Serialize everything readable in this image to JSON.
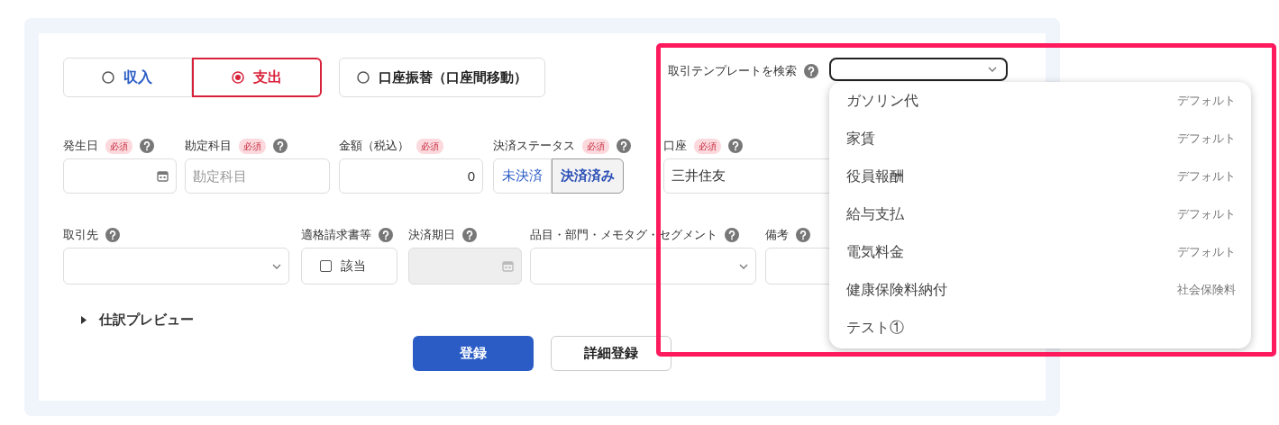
{
  "transaction_types": [
    {
      "label": "収入",
      "selected": false
    },
    {
      "label": "支出",
      "selected": true
    },
    {
      "label": "口座振替（口座間移動）",
      "selected": false
    }
  ],
  "template_search": {
    "label": "取引テンプレートを検索",
    "options": [
      {
        "name": "ガソリン代",
        "category": "デフォルト"
      },
      {
        "name": "家賃",
        "category": "デフォルト"
      },
      {
        "name": "役員報酬",
        "category": "デフォルト"
      },
      {
        "name": "給与支払",
        "category": "デフォルト"
      },
      {
        "name": "電気料金",
        "category": "デフォルト"
      },
      {
        "name": "健康保険料納付",
        "category": "社会保険料"
      },
      {
        "name": "テスト①"
      }
    ]
  },
  "fields_row1": [
    {
      "kind": "date",
      "label": "発生日",
      "badge": "必須",
      "help": true
    },
    {
      "kind": "text",
      "label": "勘定科目",
      "badge": "必須",
      "help": true,
      "placeholder": "勘定科目"
    },
    {
      "kind": "number",
      "label": "金額（税込）",
      "badge": "必須",
      "help": false,
      "value": "0"
    },
    {
      "kind": "toggle",
      "label": "決済ステータス",
      "badge": "必須",
      "help": true,
      "options": [
        {
          "label": "未決済",
          "selected": false
        },
        {
          "label": "決済済み",
          "selected": true
        }
      ]
    },
    {
      "kind": "text",
      "label": "口座",
      "badge": "必須",
      "help": true,
      "value": "三井住友"
    }
  ],
  "fields_row2": [
    {
      "kind": "select",
      "label": "取引先",
      "help": true
    },
    {
      "kind": "checkbox",
      "label": "適格請求書等",
      "help": true,
      "option": "該当",
      "checked": false
    },
    {
      "kind": "date",
      "label": "決済期日",
      "help": true,
      "disabled": true
    },
    {
      "kind": "select",
      "label": "品目・部門・メモタグ・セグメント",
      "help": true
    },
    {
      "kind": "text",
      "label": "備考",
      "help": true
    }
  ],
  "preview": {
    "label": "仕訳プレビュー",
    "expanded": false
  },
  "buttons": [
    {
      "label": "登録",
      "kind": "primary"
    },
    {
      "label": "詳細登録",
      "kind": "secondary"
    }
  ]
}
